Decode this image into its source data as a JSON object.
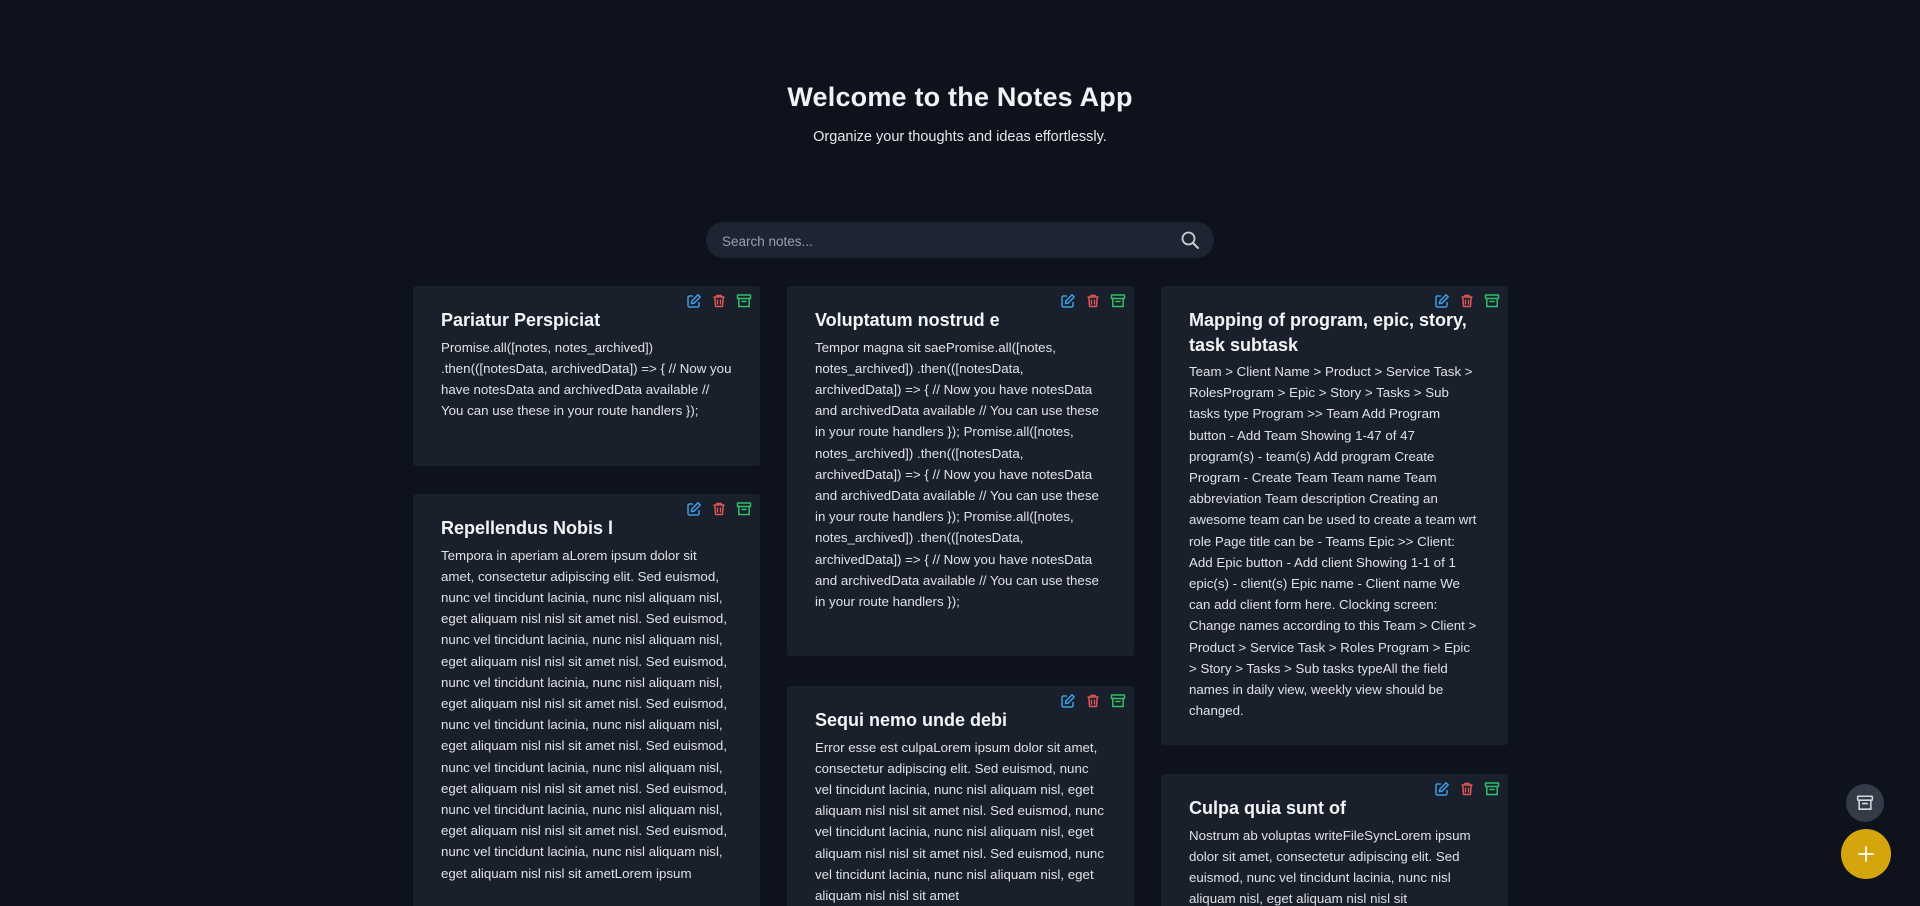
{
  "header": {
    "title": "Welcome to the Notes App",
    "subtitle": "Organize your thoughts and ideas effortlessly."
  },
  "search": {
    "placeholder": "Search notes...",
    "value": ""
  },
  "colors": {
    "background": "#0e121c",
    "card": "#1a202b",
    "edit_icon": "#3b9ee8",
    "delete_icon": "#e05555",
    "archive_icon": "#2fbf6a",
    "fab_add": "#d4a50d",
    "fab_archive": "#343b48"
  },
  "icons": {
    "edit": "edit-icon",
    "delete": "trash-icon",
    "archive": "archive-icon",
    "search": "search-icon",
    "add": "plus-icon"
  },
  "notes": [
    {
      "title": "Pariatur Perspiciat",
      "body": "Promise.all([notes, notes_archived]) .then(([notesData, archivedData]) => { // Now you have notesData and archivedData available // You can use these in your route handlers });"
    },
    {
      "title": "Repellendus Nobis l",
      "body": "Tempora in aperiam aLorem ipsum dolor sit amet, consectetur adipiscing elit. Sed euismod, nunc vel tincidunt lacinia, nunc nisl aliquam nisl, eget aliquam nisl nisl sit amet nisl. Sed euismod, nunc vel tincidunt lacinia, nunc nisl aliquam nisl, eget aliquam nisl nisl sit amet nisl. Sed euismod, nunc vel tincidunt lacinia, nunc nisl aliquam nisl, eget aliquam nisl nisl sit amet nisl. Sed euismod, nunc vel tincidunt lacinia, nunc nisl aliquam nisl, eget aliquam nisl nisl sit amet nisl. Sed euismod, nunc vel tincidunt lacinia, nunc nisl aliquam nisl, eget aliquam nisl nisl sit amet nisl. Sed euismod, nunc vel tincidunt lacinia, nunc nisl aliquam nisl, eget aliquam nisl nisl sit amet nisl. Sed euismod, nunc vel tincidunt lacinia, nunc nisl aliquam nisl, eget aliquam nisl nisl sit ametLorem ipsum"
    },
    {
      "title": "Voluptatum nostrud e",
      "body": "Tempor magna sit saePromise.all([notes, notes_archived]) .then(([notesData, archivedData]) => { // Now you have notesData and archivedData available // You can use these in your route handlers }); Promise.all([notes, notes_archived]) .then(([notesData, archivedData]) => { // Now you have notesData and archivedData available // You can use these in your route handlers }); Promise.all([notes, notes_archived]) .then(([notesData, archivedData]) => { // Now you have notesData and archivedData available // You can use these in your route handlers });"
    },
    {
      "title": "Sequi nemo unde debi",
      "body": "Error esse est culpaLorem ipsum dolor sit amet, consectetur adipiscing elit. Sed euismod, nunc vel tincidunt lacinia, nunc nisl aliquam nisl, eget aliquam nisl nisl sit amet nisl. Sed euismod, nunc vel tincidunt lacinia, nunc nisl aliquam nisl, eget aliquam nisl nisl sit amet nisl. Sed euismod, nunc vel tincidunt lacinia, nunc nisl aliquam nisl, eget aliquam nisl nisl sit amet"
    },
    {
      "title": "Mapping of program, epic, story, task subtask",
      "body": "Team > Client Name > Product > Service Task > RolesProgram > Epic > Story > Tasks > Sub tasks type Program >> Team Add Program button - Add Team Showing 1-47 of 47 program(s) - team(s) Add program Create Program - Create Team Team name Team abbreviation Team description Creating an awesome team can be used to create a team wrt role Page title can be - Teams Epic >> Client: Add Epic button - Add client Showing 1-1 of 1 epic(s) - client(s) Epic name - Client name We can add client form here. Clocking screen: Change names according to this Team > Client > Product > Service Task > Roles Program > Epic > Story > Tasks > Sub tasks typeAll the field names in daily view, weekly view should be changed."
    },
    {
      "title": "Culpa quia sunt of",
      "body": "Nostrum ab voluptas writeFileSyncLorem ipsum dolor sit amet, consectetur adipiscing elit. Sed euismod, nunc vel tincidunt lacinia, nunc nisl aliquam nisl, eget aliquam nisl nisl sit"
    }
  ]
}
